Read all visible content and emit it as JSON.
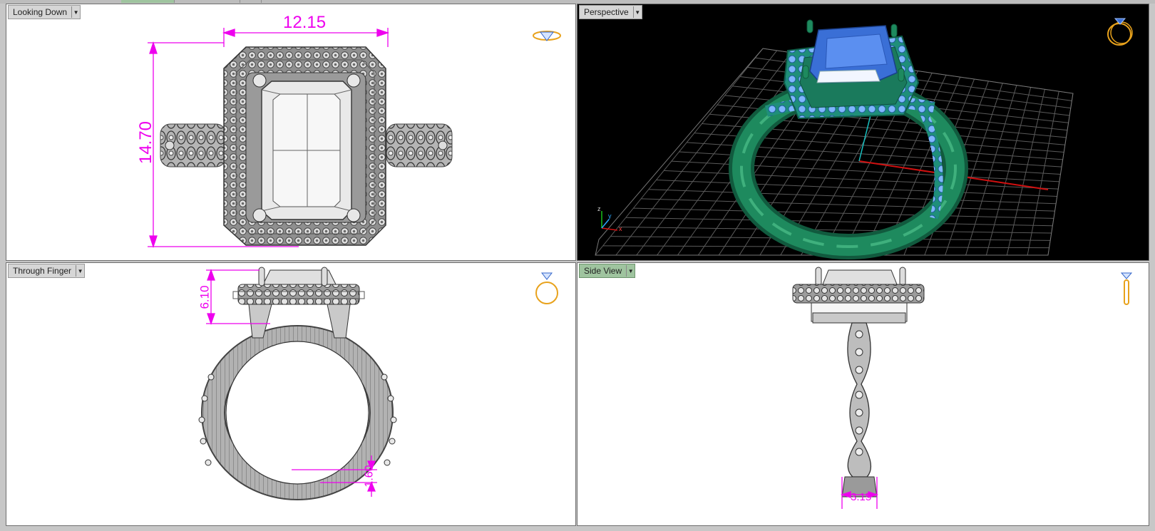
{
  "viewports": [
    {
      "id": "looking-down",
      "title": "Looking Down",
      "active": false,
      "dims": {
        "width": "12.15",
        "height": "14.70"
      }
    },
    {
      "id": "perspective",
      "title": "Perspective",
      "active": false,
      "axes": {
        "x": "x",
        "y": "y",
        "z": "z"
      }
    },
    {
      "id": "through-finger",
      "title": "Through Finger",
      "active": false,
      "dims": {
        "top": "6.10",
        "shank": "1.60"
      }
    },
    {
      "id": "side-view",
      "title": "Side View",
      "active": true,
      "dims": {
        "width": "3.15"
      }
    }
  ],
  "icons": {
    "dropdown": "chevron-down-icon",
    "view_indicator": "ring-orientation-icon"
  },
  "colors": {
    "dimension": "#ee00ee",
    "ring_perspective": "#1e8a5e",
    "stone_perspective": "#3a6fd6",
    "grid": "#5a5a5a",
    "active_title": "#9fc49f"
  }
}
